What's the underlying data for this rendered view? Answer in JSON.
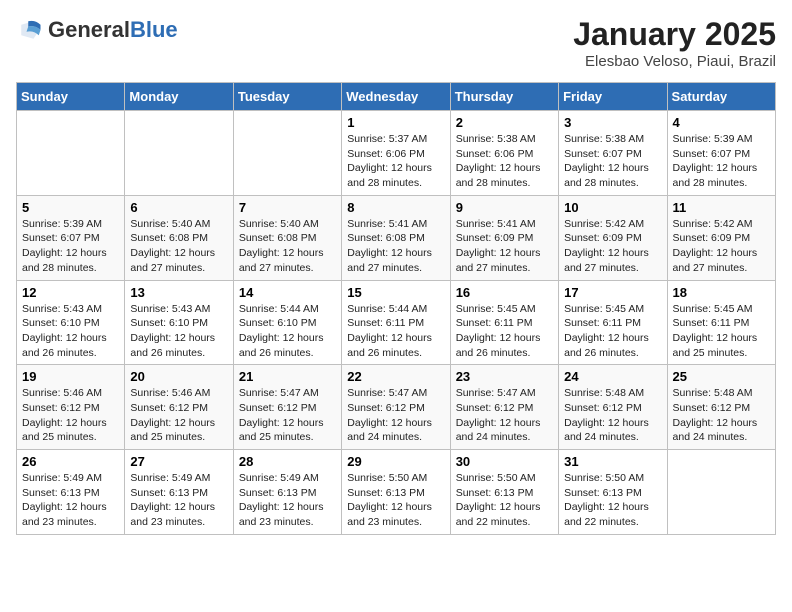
{
  "header": {
    "logo_general": "General",
    "logo_blue": "Blue",
    "month_title": "January 2025",
    "location": "Elesbao Veloso, Piaui, Brazil"
  },
  "days_of_week": [
    "Sunday",
    "Monday",
    "Tuesday",
    "Wednesday",
    "Thursday",
    "Friday",
    "Saturday"
  ],
  "weeks": [
    [
      {
        "day": "",
        "sunrise": "",
        "sunset": "",
        "daylight": ""
      },
      {
        "day": "",
        "sunrise": "",
        "sunset": "",
        "daylight": ""
      },
      {
        "day": "",
        "sunrise": "",
        "sunset": "",
        "daylight": ""
      },
      {
        "day": "1",
        "sunrise": "Sunrise: 5:37 AM",
        "sunset": "Sunset: 6:06 PM",
        "daylight": "Daylight: 12 hours and 28 minutes."
      },
      {
        "day": "2",
        "sunrise": "Sunrise: 5:38 AM",
        "sunset": "Sunset: 6:06 PM",
        "daylight": "Daylight: 12 hours and 28 minutes."
      },
      {
        "day": "3",
        "sunrise": "Sunrise: 5:38 AM",
        "sunset": "Sunset: 6:07 PM",
        "daylight": "Daylight: 12 hours and 28 minutes."
      },
      {
        "day": "4",
        "sunrise": "Sunrise: 5:39 AM",
        "sunset": "Sunset: 6:07 PM",
        "daylight": "Daylight: 12 hours and 28 minutes."
      }
    ],
    [
      {
        "day": "5",
        "sunrise": "Sunrise: 5:39 AM",
        "sunset": "Sunset: 6:07 PM",
        "daylight": "Daylight: 12 hours and 28 minutes."
      },
      {
        "day": "6",
        "sunrise": "Sunrise: 5:40 AM",
        "sunset": "Sunset: 6:08 PM",
        "daylight": "Daylight: 12 hours and 27 minutes."
      },
      {
        "day": "7",
        "sunrise": "Sunrise: 5:40 AM",
        "sunset": "Sunset: 6:08 PM",
        "daylight": "Daylight: 12 hours and 27 minutes."
      },
      {
        "day": "8",
        "sunrise": "Sunrise: 5:41 AM",
        "sunset": "Sunset: 6:08 PM",
        "daylight": "Daylight: 12 hours and 27 minutes."
      },
      {
        "day": "9",
        "sunrise": "Sunrise: 5:41 AM",
        "sunset": "Sunset: 6:09 PM",
        "daylight": "Daylight: 12 hours and 27 minutes."
      },
      {
        "day": "10",
        "sunrise": "Sunrise: 5:42 AM",
        "sunset": "Sunset: 6:09 PM",
        "daylight": "Daylight: 12 hours and 27 minutes."
      },
      {
        "day": "11",
        "sunrise": "Sunrise: 5:42 AM",
        "sunset": "Sunset: 6:09 PM",
        "daylight": "Daylight: 12 hours and 27 minutes."
      }
    ],
    [
      {
        "day": "12",
        "sunrise": "Sunrise: 5:43 AM",
        "sunset": "Sunset: 6:10 PM",
        "daylight": "Daylight: 12 hours and 26 minutes."
      },
      {
        "day": "13",
        "sunrise": "Sunrise: 5:43 AM",
        "sunset": "Sunset: 6:10 PM",
        "daylight": "Daylight: 12 hours and 26 minutes."
      },
      {
        "day": "14",
        "sunrise": "Sunrise: 5:44 AM",
        "sunset": "Sunset: 6:10 PM",
        "daylight": "Daylight: 12 hours and 26 minutes."
      },
      {
        "day": "15",
        "sunrise": "Sunrise: 5:44 AM",
        "sunset": "Sunset: 6:11 PM",
        "daylight": "Daylight: 12 hours and 26 minutes."
      },
      {
        "day": "16",
        "sunrise": "Sunrise: 5:45 AM",
        "sunset": "Sunset: 6:11 PM",
        "daylight": "Daylight: 12 hours and 26 minutes."
      },
      {
        "day": "17",
        "sunrise": "Sunrise: 5:45 AM",
        "sunset": "Sunset: 6:11 PM",
        "daylight": "Daylight: 12 hours and 26 minutes."
      },
      {
        "day": "18",
        "sunrise": "Sunrise: 5:45 AM",
        "sunset": "Sunset: 6:11 PM",
        "daylight": "Daylight: 12 hours and 25 minutes."
      }
    ],
    [
      {
        "day": "19",
        "sunrise": "Sunrise: 5:46 AM",
        "sunset": "Sunset: 6:12 PM",
        "daylight": "Daylight: 12 hours and 25 minutes."
      },
      {
        "day": "20",
        "sunrise": "Sunrise: 5:46 AM",
        "sunset": "Sunset: 6:12 PM",
        "daylight": "Daylight: 12 hours and 25 minutes."
      },
      {
        "day": "21",
        "sunrise": "Sunrise: 5:47 AM",
        "sunset": "Sunset: 6:12 PM",
        "daylight": "Daylight: 12 hours and 25 minutes."
      },
      {
        "day": "22",
        "sunrise": "Sunrise: 5:47 AM",
        "sunset": "Sunset: 6:12 PM",
        "daylight": "Daylight: 12 hours and 24 minutes."
      },
      {
        "day": "23",
        "sunrise": "Sunrise: 5:47 AM",
        "sunset": "Sunset: 6:12 PM",
        "daylight": "Daylight: 12 hours and 24 minutes."
      },
      {
        "day": "24",
        "sunrise": "Sunrise: 5:48 AM",
        "sunset": "Sunset: 6:12 PM",
        "daylight": "Daylight: 12 hours and 24 minutes."
      },
      {
        "day": "25",
        "sunrise": "Sunrise: 5:48 AM",
        "sunset": "Sunset: 6:12 PM",
        "daylight": "Daylight: 12 hours and 24 minutes."
      }
    ],
    [
      {
        "day": "26",
        "sunrise": "Sunrise: 5:49 AM",
        "sunset": "Sunset: 6:13 PM",
        "daylight": "Daylight: 12 hours and 23 minutes."
      },
      {
        "day": "27",
        "sunrise": "Sunrise: 5:49 AM",
        "sunset": "Sunset: 6:13 PM",
        "daylight": "Daylight: 12 hours and 23 minutes."
      },
      {
        "day": "28",
        "sunrise": "Sunrise: 5:49 AM",
        "sunset": "Sunset: 6:13 PM",
        "daylight": "Daylight: 12 hours and 23 minutes."
      },
      {
        "day": "29",
        "sunrise": "Sunrise: 5:50 AM",
        "sunset": "Sunset: 6:13 PM",
        "daylight": "Daylight: 12 hours and 23 minutes."
      },
      {
        "day": "30",
        "sunrise": "Sunrise: 5:50 AM",
        "sunset": "Sunset: 6:13 PM",
        "daylight": "Daylight: 12 hours and 22 minutes."
      },
      {
        "day": "31",
        "sunrise": "Sunrise: 5:50 AM",
        "sunset": "Sunset: 6:13 PM",
        "daylight": "Daylight: 12 hours and 22 minutes."
      },
      {
        "day": "",
        "sunrise": "",
        "sunset": "",
        "daylight": ""
      }
    ]
  ]
}
